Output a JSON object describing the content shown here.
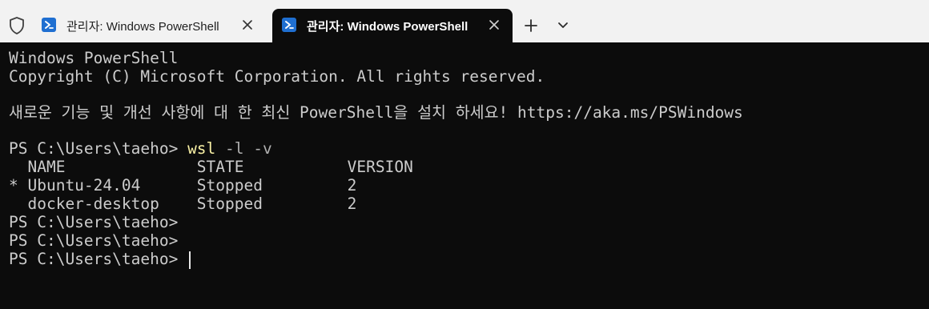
{
  "tabs": [
    {
      "label": "관리자: Windows PowerShell",
      "active": false
    },
    {
      "label": "관리자: Windows PowerShell",
      "active": true
    }
  ],
  "toolbar": {
    "new_tab_icon": "plus-icon",
    "dropdown_icon": "chevron-down-icon"
  },
  "terminal": {
    "lines": {
      "l1": "Windows PowerShell",
      "l2": "Copyright (C) Microsoft Corporation. All rights reserved.",
      "l3": "새로운 기능 및 개선 사항에 대 한 최신 PowerShell을 설치 하세요! https://aka.ms/PSWindows"
    },
    "prompt": "PS C:\\Users\\taeho> ",
    "command": {
      "name": "wsl",
      "args": " -l -v"
    },
    "table": {
      "header": "  NAME              STATE           VERSION",
      "rows": [
        "* Ubuntu-24.04      Stopped         2",
        "  docker-desktop    Stopped         2"
      ]
    },
    "trailing_prompt": "PS C:\\Users\\taeho>"
  },
  "colors": {
    "background": "#0c0c0c",
    "text": "#cccccc",
    "command": "#f9f1a5",
    "tabbar": "#f2f2f2",
    "icon_blue": "#1f6fd1"
  }
}
